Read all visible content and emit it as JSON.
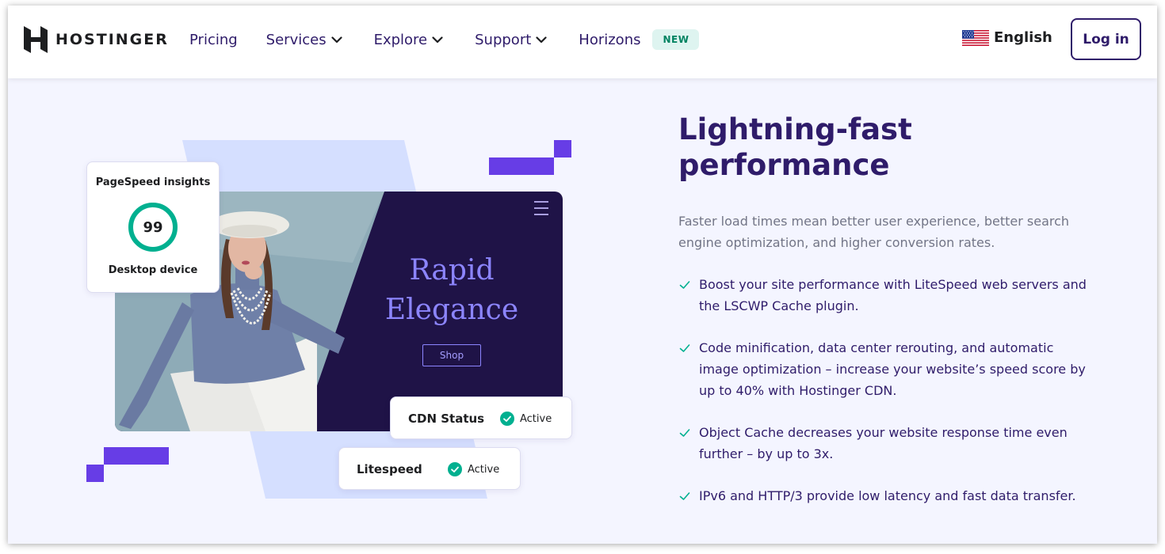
{
  "brand": {
    "name": "HOSTINGER"
  },
  "nav": {
    "items": [
      {
        "label": "Pricing",
        "has_dropdown": false
      },
      {
        "label": "Services",
        "has_dropdown": true
      },
      {
        "label": "Explore",
        "has_dropdown": true
      },
      {
        "label": "Support",
        "has_dropdown": true
      },
      {
        "label": "Horizons",
        "has_dropdown": false
      }
    ],
    "new_badge": "NEW"
  },
  "language": {
    "label": "English",
    "flag_icon": "us-flag-icon"
  },
  "login": {
    "label": "Log in"
  },
  "illustration": {
    "pagespeed": {
      "title": "PageSpeed insights",
      "score": "99",
      "device": "Desktop device",
      "score_fraction": 0.99
    },
    "hero_card": {
      "title_line1": "Rapid",
      "title_line2": "Elegance",
      "shop_label": "Shop"
    },
    "statuses": [
      {
        "name": "CDN Status",
        "value": "Active"
      },
      {
        "name": "Litespeed",
        "value": "Active"
      }
    ]
  },
  "content": {
    "headline_line1": "Lightning-fast",
    "headline_line2": "performance",
    "subtext": "Faster load times mean better user experience, better search engine optimization, and higher conversion rates.",
    "features": [
      "Boost your site performance with LiteSpeed web servers and the LSCWP Cache plugin.",
      "Code minification, data center rerouting, and automatic image optimization – increase your website’s speed score by up to 40% with Hostinger CDN.",
      "Object Cache decreases your website response time even further – by up to 3x.",
      "IPv6 and HTTP/3 provide low latency and fast data transfer."
    ]
  },
  "colors": {
    "brand_purple": "#673de6",
    "dark_purple": "#2f1c6a",
    "success_green": "#00b090",
    "background": "#f4f5ff"
  }
}
